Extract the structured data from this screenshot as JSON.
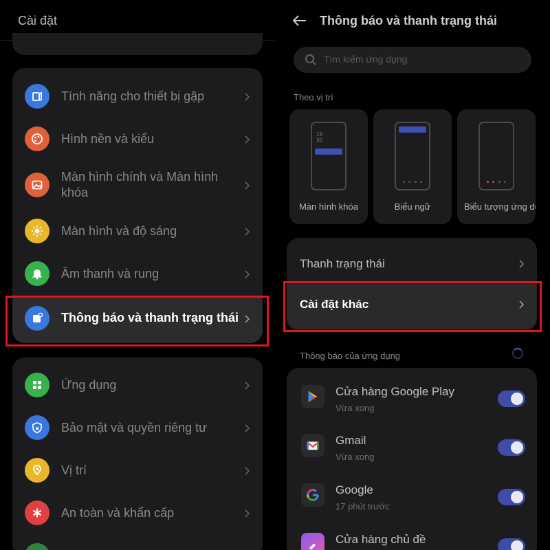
{
  "left": {
    "title": "Cài đặt",
    "items": [
      {
        "label": "Tính năng cho thiết bị gập",
        "icon": "foldable-device-icon",
        "color": "#3a78e0"
      },
      {
        "label": "Hình nền và kiểu",
        "icon": "palette-icon",
        "color": "#e0603a"
      },
      {
        "label": "Màn hình chính và Màn hình khóa",
        "icon": "image-icon",
        "color": "#e0603a"
      },
      {
        "label": "Màn hình và độ sáng",
        "icon": "sun-icon",
        "color": "#e8b82a"
      },
      {
        "label": "Âm thanh và rung",
        "icon": "bell-icon",
        "color": "#37b24d"
      },
      {
        "label": "Thông báo và thanh trạng thái",
        "icon": "notification-icon",
        "color": "#3a78e0"
      },
      {
        "label": "Ứng dụng",
        "icon": "apps-grid-icon",
        "color": "#37b24d"
      },
      {
        "label": "Bảo mật và quyền riêng tư",
        "icon": "shield-lock-icon",
        "color": "#3a78e0"
      },
      {
        "label": "Vị trí",
        "icon": "location-icon",
        "color": "#e8b82a"
      },
      {
        "label": "An toàn và khẩn cấp",
        "icon": "emergency-icon",
        "color": "#e04040"
      }
    ]
  },
  "right": {
    "title": "Thông báo và thanh trạng thái",
    "search_placeholder": "Tìm kiếm ứng dụng",
    "section_position": "Theo vị trí",
    "positions": [
      {
        "label": "Màn hình khóa"
      },
      {
        "label": "Biểu ngữ"
      },
      {
        "label": "Biểu tượng ứng dụng"
      }
    ],
    "options": [
      {
        "label": "Thanh trạng thái"
      },
      {
        "label": "Cài đặt khác"
      }
    ],
    "section_apps": "Thông báo của ứng dụng",
    "apps": [
      {
        "name": "Cửa hàng Google Play",
        "sub": "Vừa xong",
        "enabled": true
      },
      {
        "name": "Gmail",
        "sub": "Vừa xong",
        "enabled": true
      },
      {
        "name": "Google",
        "sub": "17 phút trước",
        "enabled": true
      },
      {
        "name": "Cửa hàng chủ đề",
        "sub": "",
        "enabled": true
      }
    ]
  },
  "colors": {
    "highlight": "#e0161b",
    "accent": "#3e4ea8",
    "card": "#1c1c1e"
  }
}
